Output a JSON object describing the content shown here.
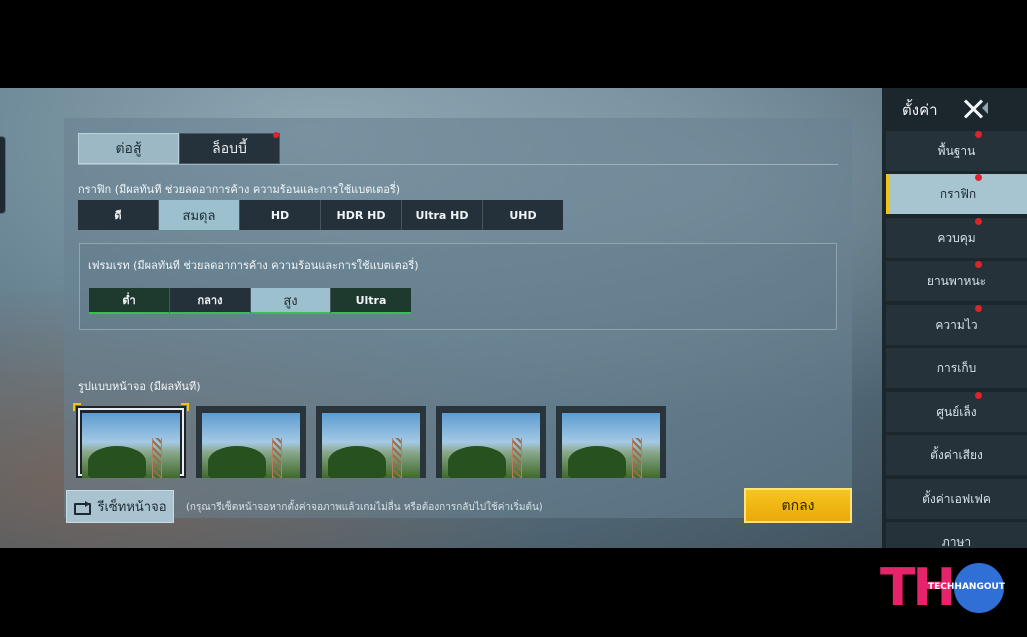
{
  "tabs": [
    {
      "label": "ต่อสู้",
      "active": true
    },
    {
      "label": "ล็อบบี้",
      "active": false,
      "badge": true
    }
  ],
  "graphics": {
    "label": "กราฟิก (มีผลทันที ช่วยลดอาการค้าง ความร้อนและการใช้แบตเตอรี่)",
    "options": [
      "ดี",
      "สมดุล",
      "HD",
      "HDR HD",
      "Ultra HD",
      "UHD"
    ],
    "selected": "สมดุล"
  },
  "framerate": {
    "label": "เฟรมเรท (มีผลทันที ช่วยลดอาการค้าง ความร้อนและการใช้แบตเตอรี่)",
    "options": [
      "ต่ำ",
      "กลาง",
      "สูง",
      "Ultra"
    ],
    "selected": "สูง"
  },
  "screen_style": {
    "label": "รูปแบบหน้าจอ (มีผลทันที)",
    "thumbnail_count": 5,
    "selected_index": 0
  },
  "footer": {
    "reset_label": "รีเซ็ทหน้าจอ",
    "hint": "(กรุณารีเซ็ตหน้าจอหากตั้งค่าจอภาพแล้วเกมไม่ลื่น หรือต้องการกลับไปใช้ค่าเริ่มต้น)",
    "ok_label": "ตกลง"
  },
  "sidebar": {
    "title": "ตั้งค่า",
    "items": [
      {
        "label": "พื้นฐาน",
        "badge": true
      },
      {
        "label": "กราฟิก",
        "badge": true,
        "active": true
      },
      {
        "label": "ควบคุม",
        "badge": true
      },
      {
        "label": "ยานพาหนะ",
        "badge": true
      },
      {
        "label": "ความไว",
        "badge": true
      },
      {
        "label": "การเก็บ",
        "badge": false
      },
      {
        "label": "ศูนย์เล็ง",
        "badge": true
      },
      {
        "label": "ตั้งค่าเสียง",
        "badge": false
      },
      {
        "label": "ตั้งค่าเอฟเฟค",
        "badge": false
      },
      {
        "label": "ภาษา",
        "badge": false
      }
    ]
  },
  "watermark": {
    "letters": "TH",
    "text": "TECHHANGOUT"
  },
  "colors": {
    "accent": "#f3c21a",
    "selected": "#9cc0cd",
    "badge": "#e0222a",
    "fps_bar": "#34c24a",
    "logo_pink": "#e6246c",
    "logo_blue": "#2f6fd6"
  }
}
